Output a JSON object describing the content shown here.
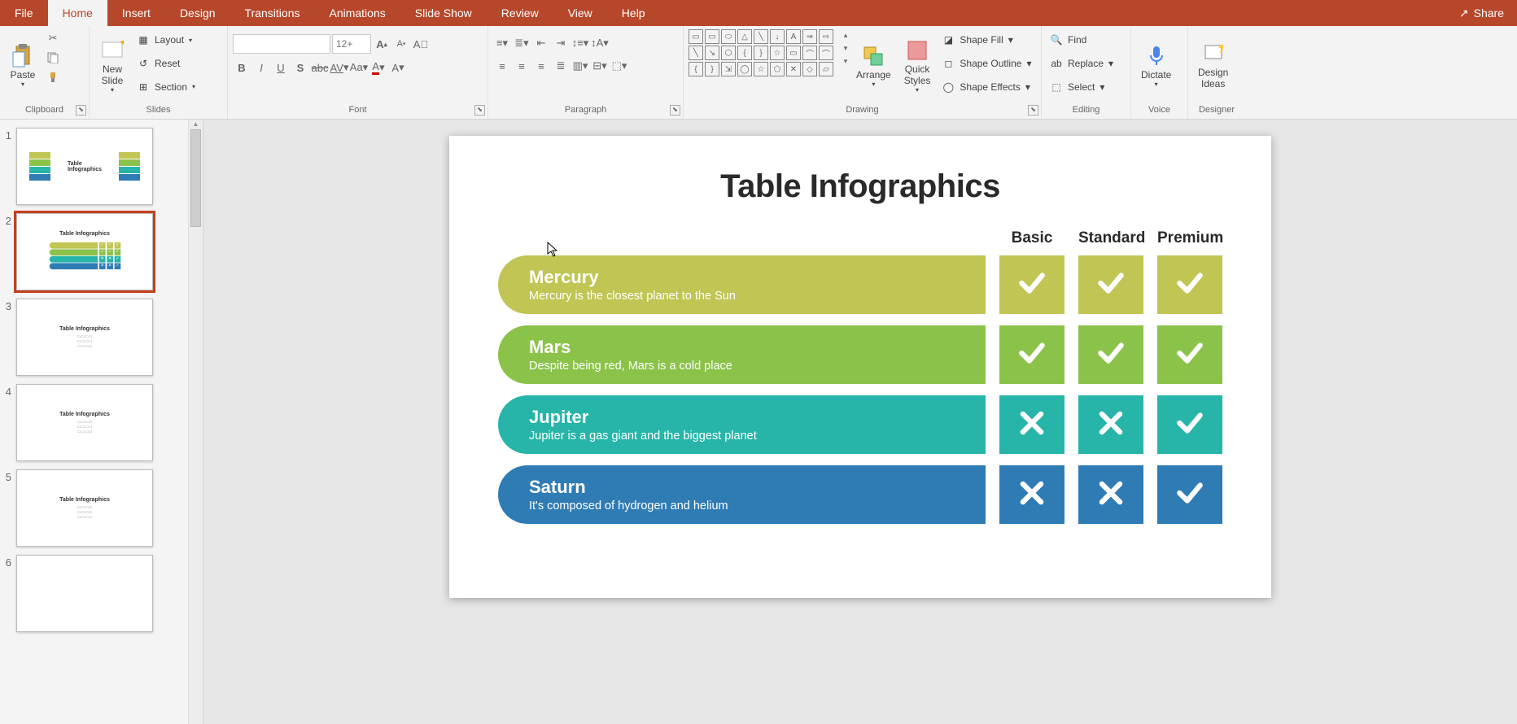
{
  "ribbon": {
    "tabs": [
      "File",
      "Home",
      "Insert",
      "Design",
      "Transitions",
      "Animations",
      "Slide Show",
      "Review",
      "View",
      "Help"
    ],
    "active_tab": "Home",
    "share": "Share",
    "groups": {
      "clipboard": {
        "label": "Clipboard",
        "paste": "Paste"
      },
      "slides": {
        "label": "Slides",
        "new_slide": "New\nSlide",
        "layout": "Layout",
        "reset": "Reset",
        "section": "Section"
      },
      "font": {
        "label": "Font",
        "size_placeholder": "12+"
      },
      "paragraph": {
        "label": "Paragraph"
      },
      "drawing": {
        "label": "Drawing",
        "arrange": "Arrange",
        "quick_styles": "Quick\nStyles",
        "shape_fill": "Shape Fill",
        "shape_outline": "Shape Outline",
        "shape_effects": "Shape Effects"
      },
      "editing": {
        "label": "Editing",
        "find": "Find",
        "replace": "Replace",
        "select": "Select"
      },
      "voice": {
        "label": "Voice",
        "dictate": "Dictate"
      },
      "designer": {
        "label": "Designer",
        "design_ideas": "Design\nIdeas"
      }
    }
  },
  "thumbnails": {
    "selected": 2,
    "slides": [
      {
        "num": "1",
        "title": "Table\nInfographics"
      },
      {
        "num": "2",
        "title": "Table Infographics"
      },
      {
        "num": "3",
        "title": "Table Infographics"
      },
      {
        "num": "4",
        "title": "Table Infographics"
      },
      {
        "num": "5",
        "title": "Table Infographics"
      },
      {
        "num": "6",
        "title": ""
      }
    ]
  },
  "slide": {
    "title": "Table Infographics",
    "columns": [
      "Basic",
      "Standard",
      "Premium"
    ],
    "rows": [
      {
        "planet": "Mercury",
        "desc": "Mercury is the closest planet to the Sun",
        "class": "c-olive",
        "cells": [
          "check",
          "check",
          "check"
        ]
      },
      {
        "planet": "Mars",
        "desc": "Despite being red, Mars is a cold place",
        "class": "c-green",
        "cells": [
          "check",
          "check",
          "check"
        ]
      },
      {
        "planet": "Jupiter",
        "desc": "Jupiter is a gas giant and the biggest planet",
        "class": "c-teal",
        "cells": [
          "cross",
          "cross",
          "check"
        ]
      },
      {
        "planet": "Saturn",
        "desc": "It's composed of hydrogen and helium",
        "class": "c-blue",
        "cells": [
          "cross",
          "cross",
          "check"
        ]
      }
    ]
  },
  "chart_data": {
    "type": "table",
    "title": "Table Infographics",
    "columns": [
      "Basic",
      "Standard",
      "Premium"
    ],
    "rows": [
      {
        "label": "Mercury",
        "desc": "Mercury is the closest planet to the Sun",
        "values": [
          true,
          true,
          true
        ]
      },
      {
        "label": "Mars",
        "desc": "Despite being red, Mars is a cold place",
        "values": [
          true,
          true,
          true
        ]
      },
      {
        "label": "Jupiter",
        "desc": "Jupiter is a gas giant and the biggest planet",
        "values": [
          false,
          false,
          true
        ]
      },
      {
        "label": "Saturn",
        "desc": "It's composed of hydrogen and helium",
        "values": [
          false,
          false,
          true
        ]
      }
    ]
  }
}
